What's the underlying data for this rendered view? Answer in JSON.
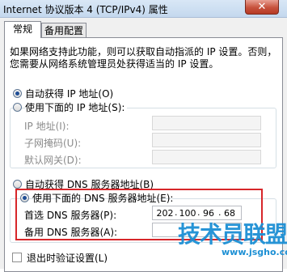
{
  "window": {
    "title": "Internet 协议版本 4 (TCP/IPv4) 属性",
    "close_glyph": "✕"
  },
  "tabs": [
    {
      "label": "常规",
      "selected": true
    },
    {
      "label": "备用配置",
      "selected": false
    }
  ],
  "intro_text": {
    "line1": "如果网络支持此功能，则可以获取自动指派的 IP 设置。否则，",
    "line2": "您需要从网络系统管理员处获得适当的 IP 设置。"
  },
  "ip_section": {
    "auto_label": "自动获得 IP 地址(O)",
    "auto_selected": true,
    "manual_label": "使用下面的 IP 地址(S):",
    "manual_selected": false,
    "fields": [
      {
        "label": "IP 地址(I):",
        "value": ""
      },
      {
        "label": "子网掩码(U):",
        "value": ""
      },
      {
        "label": "默认网关(D):",
        "value": ""
      }
    ]
  },
  "dns_section": {
    "auto_label": "自动获得 DNS 服务器地址(B)",
    "auto_selected": false,
    "manual_label": "使用下面的 DNS 服务器地址(E):",
    "manual_selected": true,
    "preferred": {
      "label": "首选 DNS 服务器(P):",
      "segments": [
        "202",
        "100",
        "96",
        "68"
      ]
    },
    "alternate": {
      "label": "备用 DNS 服务器(A):",
      "segments": [
        "",
        "",
        "",
        ""
      ]
    }
  },
  "validate_checkbox": {
    "label": "退出时验证设置(L)",
    "checked": false
  },
  "watermark": {
    "text": "技术员联盟",
    "url": "www.jsgho.com"
  },
  "colors": {
    "highlight_frame": "#d7262a",
    "watermark": "#1c8fd4"
  }
}
